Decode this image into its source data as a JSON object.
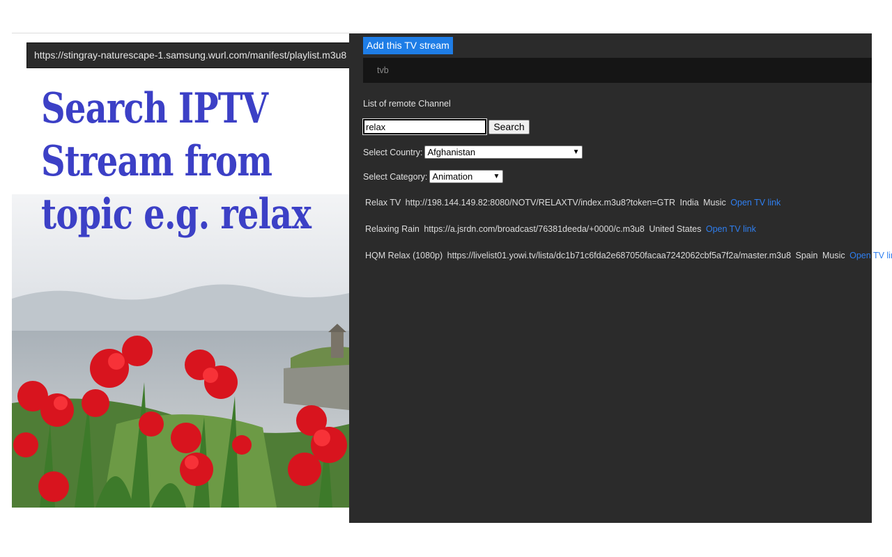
{
  "left": {
    "stream_url": "https://stingray-naturescape-1.samsung.wurl.com/manifest/playlist.m3u8",
    "promo_lines": [
      "Search IPTV",
      "Stream from",
      "topic e.g. relax"
    ]
  },
  "panel": {
    "add_button_label": "Add this TV stream",
    "stream_name": "tvb",
    "list_label": "List of remote Channel",
    "search_value": "relax",
    "search_button_label": "Search",
    "country_label": "Select Country:",
    "country_selected": "Afghanistan",
    "category_label": "Select Category:",
    "category_selected": "Animation",
    "results": [
      {
        "name": "Relax TV",
        "url": "http://198.144.149.82:8080/NOTV/RELAXTV/index.m3u8?token=GTR",
        "country": "India",
        "category": "Music",
        "link": "Open TV link"
      },
      {
        "name": "Relaxing Rain",
        "url": "https://a.jsrdn.com/broadcast/76381deeda/+0000/c.m3u8",
        "country": "United States",
        "category": "",
        "link": "Open TV link"
      },
      {
        "name": "HQM Relax (1080p)",
        "url": "https://livelist01.yowi.tv/lista/dc1b71c6fda2e687050facaa7242062cbf5a7f2a/master.m3u8",
        "country": "Spain",
        "category": "Music",
        "link": "Open TV link"
      }
    ]
  },
  "colors": {
    "panel_bg": "#2b2b2b",
    "accent_button": "#1e7de6",
    "link": "#2f7ff0",
    "promo_text": "#3c40c6"
  },
  "icons": {
    "select_arrow": "chevron-down-icon"
  }
}
